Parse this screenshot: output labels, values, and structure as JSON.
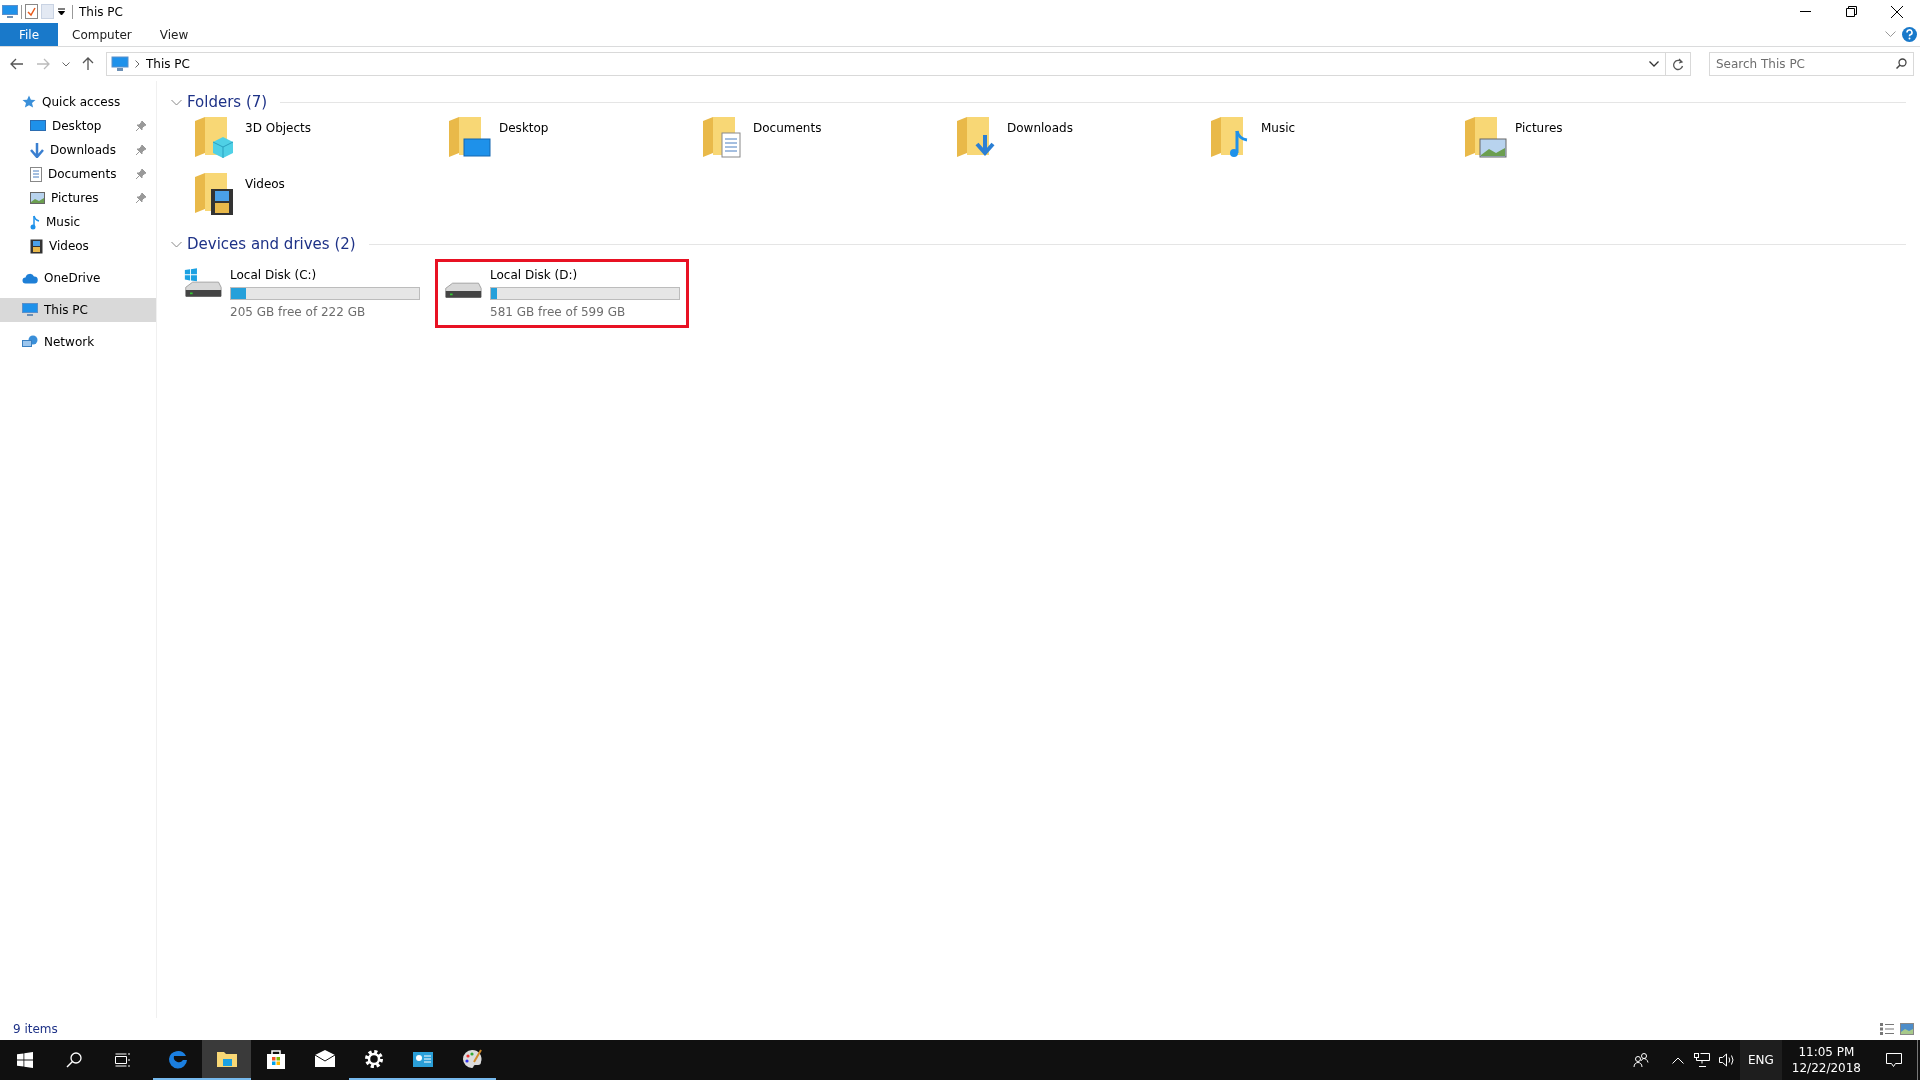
{
  "window": {
    "title": "This PC"
  },
  "ribbon_tabs": [
    {
      "label": "File",
      "kind": "file",
      "selected": false
    },
    {
      "label": "Computer",
      "kind": "tab",
      "selected": false
    },
    {
      "label": "View",
      "kind": "tab",
      "selected": false
    }
  ],
  "address_bar": {
    "path": "This PC"
  },
  "search": {
    "placeholder": "Search This PC"
  },
  "sidebar": {
    "items": [
      {
        "label": "Quick access",
        "kind": "star",
        "selected": false,
        "children": [
          {
            "label": "Desktop",
            "kind": "desktop",
            "pinned": true,
            "selected": false
          },
          {
            "label": "Downloads",
            "kind": "downloads",
            "pinned": true,
            "selected": false
          },
          {
            "label": "Documents",
            "kind": "documents",
            "pinned": true,
            "selected": false
          },
          {
            "label": "Pictures",
            "kind": "pictures",
            "pinned": true,
            "selected": false
          },
          {
            "label": "Music",
            "kind": "music",
            "pinned": false,
            "selected": false
          },
          {
            "label": "Videos",
            "kind": "videos",
            "pinned": false,
            "selected": false
          }
        ]
      },
      {
        "label": "OneDrive",
        "kind": "cloud",
        "selected": false
      },
      {
        "label": "This PC",
        "kind": "pc",
        "selected": true
      },
      {
        "label": "Network",
        "kind": "network",
        "selected": false
      }
    ]
  },
  "folders": {
    "heading": "Folders (7)",
    "expanded": true,
    "items": [
      {
        "label": "3D Objects",
        "kind": "cube"
      },
      {
        "label": "Desktop",
        "kind": "desktop"
      },
      {
        "label": "Documents",
        "kind": "documents"
      },
      {
        "label": "Downloads",
        "kind": "downloads"
      },
      {
        "label": "Music",
        "kind": "music"
      },
      {
        "label": "Pictures",
        "kind": "pictures"
      },
      {
        "label": "Videos",
        "kind": "videos"
      }
    ]
  },
  "drives": {
    "heading": "Devices and drives (2)",
    "expanded": true,
    "items": [
      {
        "label": "Local Disk (C:)",
        "kind": "system",
        "level": 0.08,
        "reading": "205 GB free of 222 GB",
        "highlighted": false
      },
      {
        "label": "Local Disk (D:)",
        "kind": "disk",
        "level": 0.03,
        "reading": "581 GB free of 599 GB",
        "highlighted": true
      }
    ]
  },
  "status_bar": {
    "text": "9 items"
  },
  "taskbar": {
    "apps": [
      {
        "kind": "edge",
        "running": true,
        "selected": false
      },
      {
        "kind": "explorer",
        "running": true,
        "selected": true
      },
      {
        "kind": "store",
        "running": false,
        "selected": false
      },
      {
        "kind": "mail",
        "running": false,
        "selected": false
      },
      {
        "kind": "settings",
        "running": true,
        "selected": false
      },
      {
        "kind": "control",
        "running": true,
        "selected": false
      },
      {
        "kind": "paint",
        "running": true,
        "selected": false
      }
    ],
    "language": "ENG",
    "time": "11:05 PM",
    "date": "12/22/2018"
  }
}
